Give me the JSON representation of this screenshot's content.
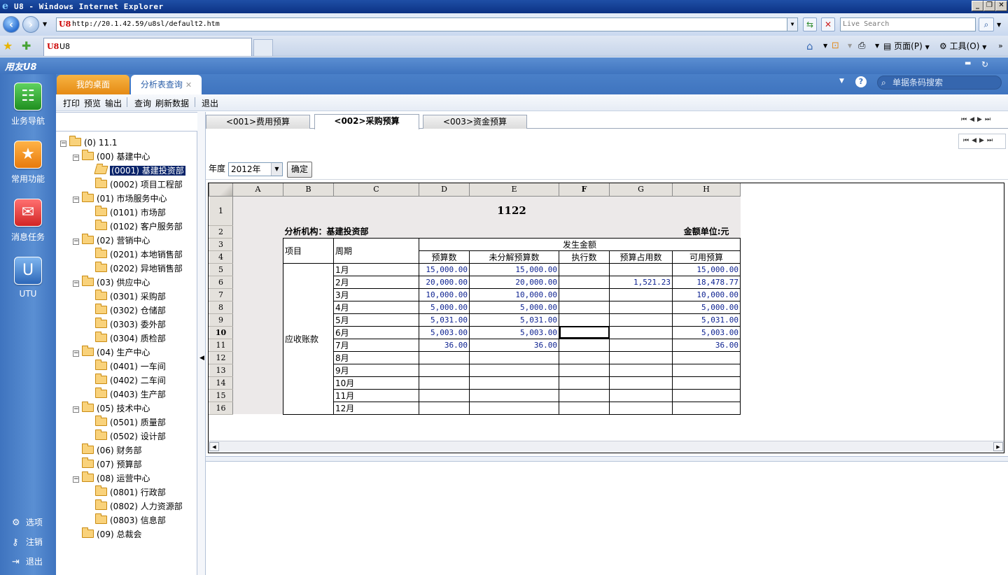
{
  "window": {
    "title": "U8 - Windows Internet Explorer"
  },
  "browser": {
    "url": "http://20.1.42.59/u8sl/default2.htm",
    "search_placeholder": "Live Search",
    "tab_label": "U8",
    "commands": {
      "page": "页面(P)",
      "tools": "工具(O)"
    }
  },
  "app": {
    "logo": "用友U8",
    "nav": [
      {
        "label": "业务导航",
        "icon": "tree-icon"
      },
      {
        "label": "常用功能",
        "icon": "star-icon"
      },
      {
        "label": "消息任务",
        "icon": "mail-icon"
      },
      {
        "label": "UTU",
        "icon": "utu-icon"
      }
    ],
    "nav_bottom": [
      {
        "label": "选项",
        "icon": "gear-icon"
      },
      {
        "label": "注销",
        "icon": "key-icon"
      },
      {
        "label": "退出",
        "icon": "exit-icon"
      }
    ],
    "tabs": [
      {
        "label": "我的桌面"
      },
      {
        "label": "分析表查询"
      }
    ],
    "search_placeholder": "单据条码搜索",
    "toolbar": [
      "打印",
      "预览",
      "输出",
      "查询",
      "刷新数据",
      "退出"
    ]
  },
  "tree": {
    "root": "(0) 11.1",
    "nodes": [
      {
        "label": "(00) 基建中心",
        "level": 1
      },
      {
        "label": "(0001) 基建投资部",
        "level": 2,
        "selected": true
      },
      {
        "label": "(0002) 项目工程部",
        "level": 2
      },
      {
        "label": "(01) 市场服务中心",
        "level": 1
      },
      {
        "label": "(0101) 市场部",
        "level": 2
      },
      {
        "label": "(0102) 客户服务部",
        "level": 2
      },
      {
        "label": "(02) 营销中心",
        "level": 1
      },
      {
        "label": "(0201) 本地销售部",
        "level": 2
      },
      {
        "label": "(0202) 异地销售部",
        "level": 2
      },
      {
        "label": "(03) 供应中心",
        "level": 1
      },
      {
        "label": "(0301) 采购部",
        "level": 2
      },
      {
        "label": "(0302) 仓储部",
        "level": 2
      },
      {
        "label": "(0303) 委外部",
        "level": 2
      },
      {
        "label": "(0304) 质检部",
        "level": 2
      },
      {
        "label": "(04) 生产中心",
        "level": 1
      },
      {
        "label": "(0401) 一车间",
        "level": 2
      },
      {
        "label": "(0402) 二车间",
        "level": 2
      },
      {
        "label": "(0403) 生产部",
        "level": 2
      },
      {
        "label": "(05) 技术中心",
        "level": 1
      },
      {
        "label": "(0501) 质量部",
        "level": 2
      },
      {
        "label": "(0502) 设计部",
        "level": 2
      },
      {
        "label": "(06) 财务部",
        "level": 1,
        "leaf": true
      },
      {
        "label": "(07) 预算部",
        "level": 1,
        "leaf": true
      },
      {
        "label": "(08) 运营中心",
        "level": 1
      },
      {
        "label": "(0801) 行政部",
        "level": 2
      },
      {
        "label": "(0802) 人力资源部",
        "level": 2
      },
      {
        "label": "(0803) 信息部",
        "level": 2
      },
      {
        "label": "(09) 总裁会",
        "level": 1,
        "leaf": true
      }
    ]
  },
  "subtabs": [
    "<001>费用预算",
    "<002>采购预算",
    "<003>资金预算"
  ],
  "filter": {
    "year_label": "年度",
    "year_value": "2012年",
    "ok_label": "确定"
  },
  "sheet": {
    "col_headers": [
      "A",
      "B",
      "C",
      "D",
      "E",
      "F",
      "G",
      "H"
    ],
    "row_headers": [
      "1",
      "2",
      "3",
      "4",
      "5",
      "6",
      "7",
      "8",
      "9",
      "10",
      "11",
      "12",
      "13",
      "14",
      "15",
      "16"
    ],
    "title": "1122",
    "org_label": "分析机构：基建投资部",
    "unit_label": "金额单位:元",
    "item_header": "项目",
    "period_header": "周期",
    "group_header": "发生金额",
    "value_headers": [
      "预算数",
      "未分解预算数",
      "执行数",
      "预算占用数",
      "可用预算"
    ],
    "item_value": "应收账款",
    "rows": [
      {
        "period": "1月",
        "vals": [
          "15,000.00",
          "15,000.00",
          "",
          "",
          "15,000.00"
        ]
      },
      {
        "period": "2月",
        "vals": [
          "20,000.00",
          "20,000.00",
          "",
          "1,521.23",
          "18,478.77"
        ]
      },
      {
        "period": "3月",
        "vals": [
          "10,000.00",
          "10,000.00",
          "",
          "",
          "10,000.00"
        ]
      },
      {
        "period": "4月",
        "vals": [
          "5,000.00",
          "5,000.00",
          "",
          "",
          "5,000.00"
        ]
      },
      {
        "period": "5月",
        "vals": [
          "5,031.00",
          "5,031.00",
          "",
          "",
          "5,031.00"
        ]
      },
      {
        "period": "6月",
        "vals": [
          "5,003.00",
          "5,003.00",
          "",
          "",
          "5,003.00"
        ]
      },
      {
        "period": "7月",
        "vals": [
          "36.00",
          "36.00",
          "",
          "",
          "36.00"
        ]
      },
      {
        "period": "8月",
        "vals": [
          "",
          "",
          "",
          "",
          ""
        ]
      },
      {
        "period": "9月",
        "vals": [
          "",
          "",
          "",
          "",
          ""
        ]
      },
      {
        "period": "10月",
        "vals": [
          "",
          "",
          "",
          "",
          ""
        ]
      },
      {
        "period": "11月",
        "vals": [
          "",
          "",
          "",
          "",
          ""
        ]
      },
      {
        "period": "12月",
        "vals": [
          "",
          "",
          "",
          "",
          ""
        ]
      }
    ]
  }
}
